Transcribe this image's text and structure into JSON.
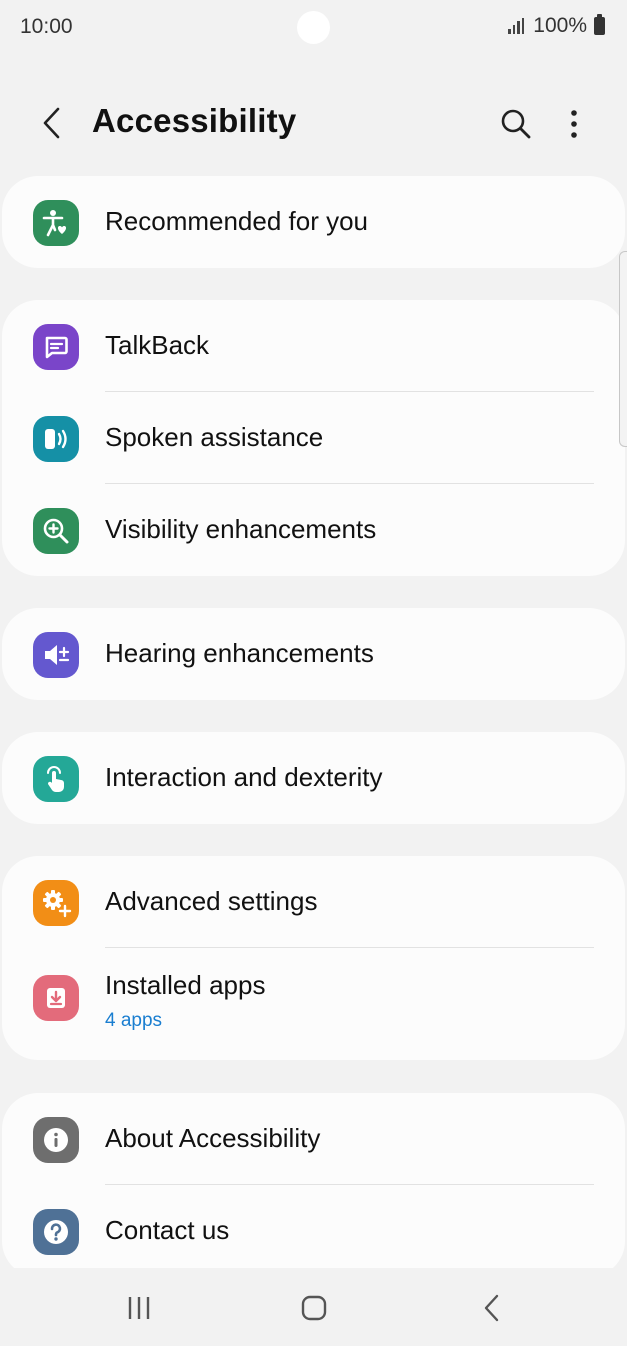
{
  "status_bar": {
    "time": "10:00",
    "battery": "100%"
  },
  "app_bar": {
    "title": "Accessibility",
    "back_icon": "chevron-left-icon",
    "search_icon": "search-icon",
    "more_icon": "more-vert-icon"
  },
  "groups": [
    {
      "items": [
        {
          "label": "Recommended for you",
          "icon": "accessibility-person-icon",
          "color": "#2f8f5b"
        }
      ]
    },
    {
      "items": [
        {
          "label": "TalkBack",
          "icon": "talkback-chat-icon",
          "color": "#7a45c9"
        },
        {
          "label": "Spoken assistance",
          "icon": "spoken-assistance-icon",
          "color": "#1590a6"
        },
        {
          "label": "Visibility enhancements",
          "icon": "zoom-in-icon",
          "color": "#2f8f5b"
        }
      ]
    },
    {
      "items": [
        {
          "label": "Hearing enhancements",
          "icon": "volume-plus-icon",
          "color": "#6458cf"
        }
      ]
    },
    {
      "items": [
        {
          "label": "Interaction and dexterity",
          "icon": "touch-hand-icon",
          "color": "#24a897"
        }
      ]
    },
    {
      "items": [
        {
          "label": "Advanced settings",
          "icon": "gear-plus-icon",
          "color": "#f28e16"
        },
        {
          "label": "Installed apps",
          "sublabel": "4 apps",
          "icon": "download-tray-icon",
          "color": "#e36b7b"
        }
      ]
    },
    {
      "items": [
        {
          "label": "About Accessibility",
          "icon": "info-icon",
          "color": "#6e6e6e"
        },
        {
          "label": "Contact us",
          "icon": "help-question-icon",
          "color": "#4f7196"
        }
      ]
    }
  ],
  "nav_bar": {
    "recent_icon": "recent-apps-icon",
    "home_icon": "home-icon",
    "back_icon": "back-icon"
  }
}
